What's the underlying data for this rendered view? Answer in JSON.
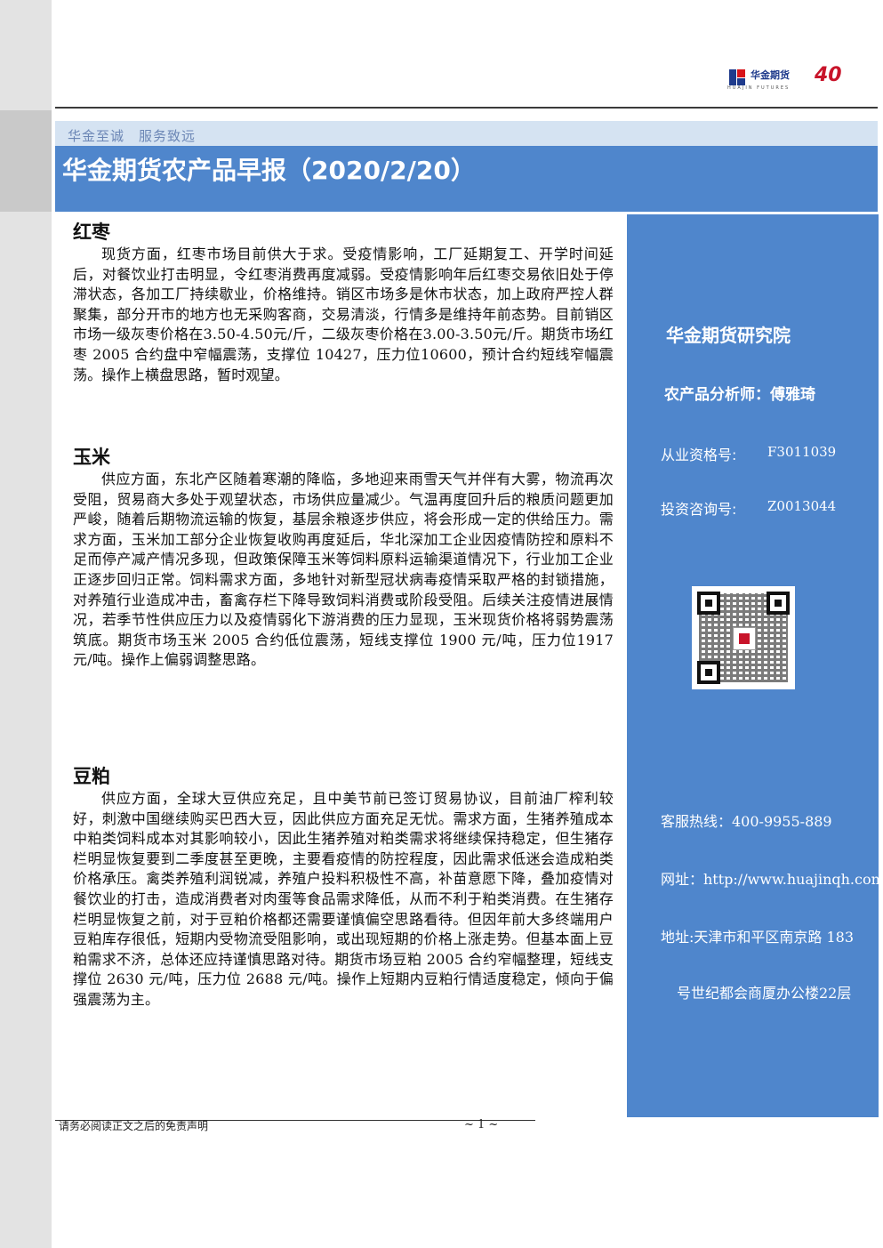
{
  "header": {
    "logo_name": "华金期货",
    "logo_sub": "HUAJIN FUTURES",
    "logo_anniv": "40",
    "slogan": "华金至诚　服务致远",
    "title": "华金期货农产品早报（2020/2/20）"
  },
  "sections": [
    {
      "heading": "红枣",
      "body": "现货方面，红枣市场目前供大于求。受疫情影响，工厂延期复工、开学时间延后，对餐饮业打击明显，令红枣消费再度减弱。受疫情影响年后红枣交易依旧处于停滞状态，各加工厂持续歇业，价格维持。销区市场多是休市状态，加上政府严控人群聚集，部分开市的地方也无采购客商，交易清淡，行情多是维持年前态势。目前销区市场一级灰枣价格在3.50-4.50元/斤，二级灰枣价格在3.00-3.50元/斤。期货市场红枣 2005 合约盘中窄幅震荡，支撑位 10427，压力位10600，预计合约短线窄幅震荡。操作上横盘思路，暂时观望。"
    },
    {
      "heading": "玉米",
      "body": "供应方面，东北产区随着寒潮的降临，多地迎来雨雪天气并伴有大雾，物流再次受阻，贸易商大多处于观望状态，市场供应量减少。气温再度回升后的粮质问题更加严峻，随着后期物流运输的恢复，基层余粮逐步供应，将会形成一定的供给压力。需求方面，玉米加工部分企业恢复收购再度延后，华北深加工企业因疫情防控和原料不足而停产减产情况多现，但政策保障玉米等饲料原料运输渠道情况下，行业加工企业正逐步回归正常。饲料需求方面，多地针对新型冠状病毒疫情采取严格的封锁措施，对养殖行业造成冲击，畜禽存栏下降导致饲料消费或阶段受阻。后续关注疫情进展情况，若季节性供应压力以及疫情弱化下游消费的压力显现，玉米现货价格将弱势震荡筑底。期货市场玉米 2005 合约低位震荡，短线支撑位 1900 元/吨，压力位1917 元/吨。操作上偏弱调整思路。"
    },
    {
      "heading": "豆粕",
      "body": "供应方面，全球大豆供应充足，且中美节前已签订贸易协议，目前油厂榨利较好，刺激中国继续购买巴西大豆，因此供应方面充足无忧。需求方面，生猪养殖成本中粕类饲料成本对其影响较小，因此生猪养殖对粕类需求将继续保持稳定，但生猪存栏明显恢复要到二季度甚至更晚，主要看疫情的防控程度，因此需求低迷会造成粕类价格承压。禽类养殖利润锐减，养殖户投料积极性不高，补苗意愿下降，叠加疫情对餐饮业的打击，造成消费者对肉蛋等食品需求降低，从而不利于粕类消费。在生猪存栏明显恢复之前，对于豆粕价格都还需要谨慎偏空思路看待。但因年前大多终端用户豆粕库存很低，短期内受物流受阻影响，或出现短期的价格上涨走势。但基本面上豆粕需求不济，总体还应持谨慎思路对待。期货市场豆粕 2005 合约窄幅整理，短线支撑位 2630 元/吨，压力位 2688 元/吨。操作上短期内豆粕行情适度稳定，倾向于偏强震荡为主。"
    }
  ],
  "sidebar": {
    "institute": "华金期货研究院",
    "analyst": "农产品分析师：傅雅琦",
    "qual_label": "从业资格号:",
    "qual_value": "F3011039",
    "consult_label": "投资咨询号:",
    "consult_value": "Z0013044",
    "hotline": "客服热线：400-9955-889",
    "website": "网址：http://www.huajinqh.com/",
    "address_1": "地址:天津市和平区南京路 183",
    "address_2": "号世纪都会商厦办公楼22层"
  },
  "footer": {
    "disclaimer": "请务必阅读正文之后的免责声明",
    "page": "~ 1 ~"
  },
  "colors": {
    "accent": "#4f86cc",
    "slogan_bg": "#d5e3f2",
    "brand_red": "#c8142a",
    "brand_blue": "#1f3b8c"
  }
}
